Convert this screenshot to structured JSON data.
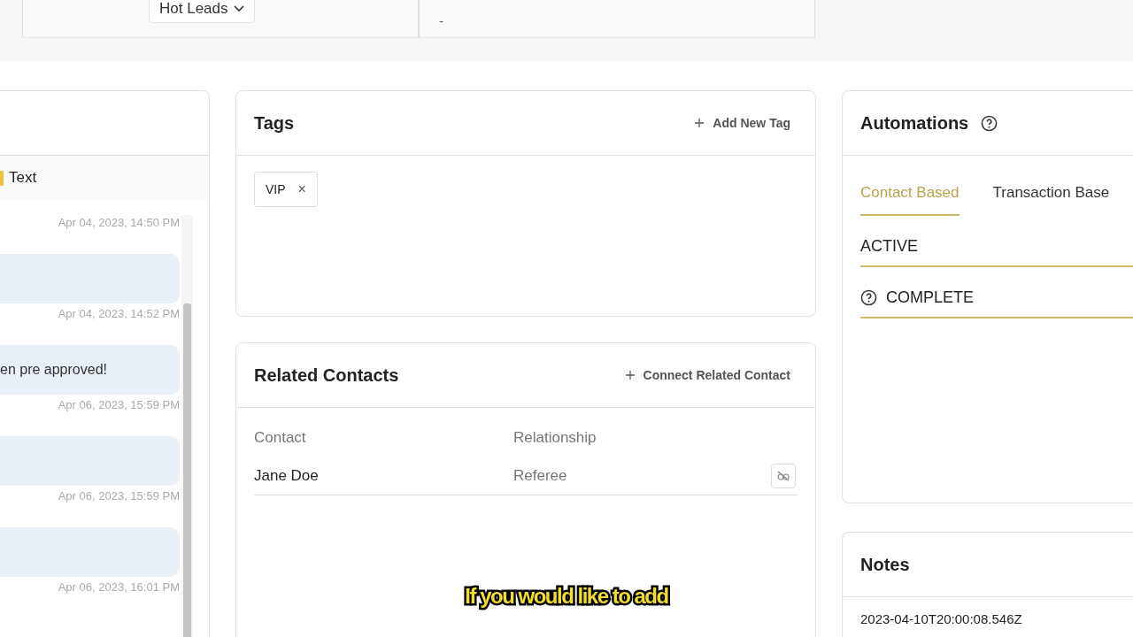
{
  "top_bar": {
    "lead_status": "Hot Leads",
    "email_detail": "-"
  },
  "conversation": {
    "tab": "Text",
    "items": [
      {
        "kind": "time",
        "text": "Apr 04, 2023, 14:50 PM"
      },
      {
        "kind": "bubble"
      },
      {
        "kind": "time",
        "text": "Apr 04, 2023, 14:52 PM"
      },
      {
        "kind": "bubble",
        "text": "en pre approved!"
      },
      {
        "kind": "time",
        "text": "Apr 06, 2023, 15:59 PM"
      },
      {
        "kind": "bubble"
      },
      {
        "kind": "time",
        "text": "Apr 06, 2023, 15:59 PM"
      },
      {
        "kind": "bubble"
      },
      {
        "kind": "time",
        "text": "Apr 06, 2023, 16:01 PM"
      }
    ]
  },
  "tags": {
    "title": "Tags",
    "action": "Add New Tag",
    "items": [
      {
        "label": "VIP",
        "remove": "×"
      }
    ]
  },
  "related_contacts": {
    "title": "Related Contacts",
    "action": "Connect Related Contact",
    "columns": [
      "Contact",
      "Relationship"
    ],
    "rows": [
      {
        "contact": "Jane Doe",
        "relationship": "Referee"
      }
    ]
  },
  "automations": {
    "title": "Automations",
    "tabs": [
      {
        "label": "Contact Based",
        "selected": true
      },
      {
        "label": "Transaction Base",
        "selected": false
      }
    ],
    "sections": [
      {
        "label": "ACTIVE",
        "help": false
      },
      {
        "label": "COMPLETE",
        "help": true
      }
    ]
  },
  "notes": {
    "title": "Notes",
    "items": [
      "2023-04-10T20:00:08.546Z"
    ]
  },
  "caption": "If you would like to add"
}
